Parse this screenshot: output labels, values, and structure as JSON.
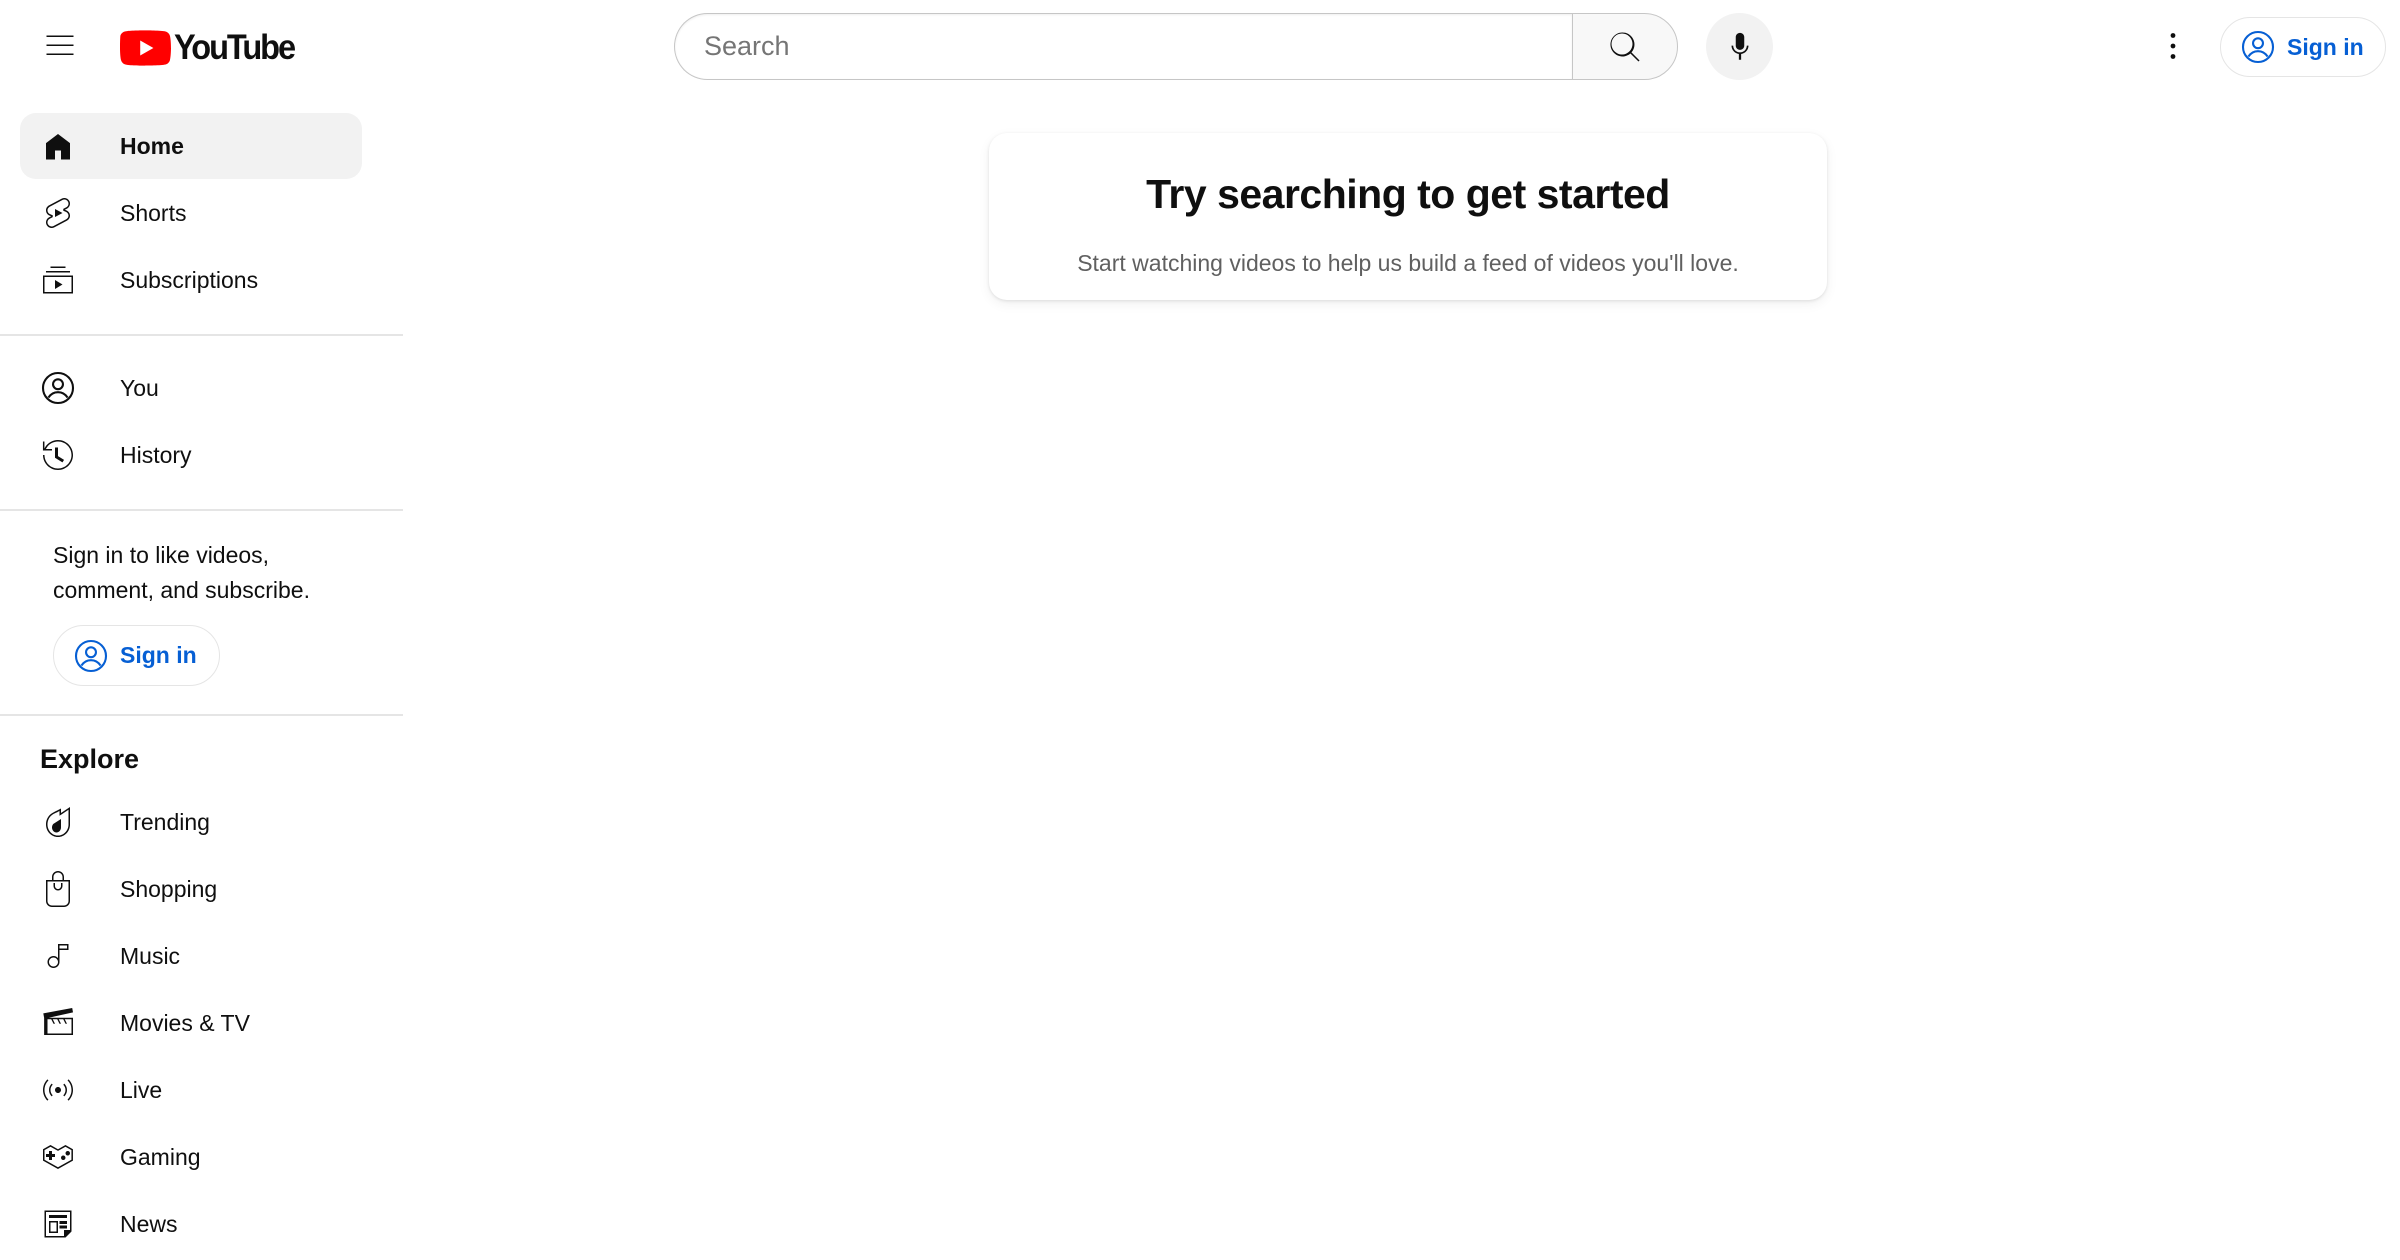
{
  "header": {
    "logo_text": "YouTube",
    "search_placeholder": "Search",
    "signin_label": "Sign in"
  },
  "sidebar": {
    "main_items": [
      {
        "label": "Home",
        "icon": "home-icon",
        "active": true
      },
      {
        "label": "Shorts",
        "icon": "shorts-icon"
      },
      {
        "label": "Subscriptions",
        "icon": "subscriptions-icon"
      }
    ],
    "you_items": [
      {
        "label": "You",
        "icon": "account-icon"
      },
      {
        "label": "History",
        "icon": "history-icon"
      }
    ],
    "signin_prompt": "Sign in to like videos, comment, and subscribe.",
    "signin_label": "Sign in",
    "explore_title": "Explore",
    "explore_items": [
      {
        "label": "Trending",
        "icon": "trending-icon"
      },
      {
        "label": "Shopping",
        "icon": "shopping-icon"
      },
      {
        "label": "Music",
        "icon": "music-icon"
      },
      {
        "label": "Movies & TV",
        "icon": "movies-icon"
      },
      {
        "label": "Live",
        "icon": "live-icon"
      },
      {
        "label": "Gaming",
        "icon": "gaming-icon"
      },
      {
        "label": "News",
        "icon": "news-icon"
      }
    ]
  },
  "main": {
    "title": "Try searching to get started",
    "subtitle": "Start watching videos to help us build a feed of videos you'll love."
  },
  "colors": {
    "brand_red": "#ff0000",
    "link_blue": "#065fd4",
    "text_primary": "#0f0f0f",
    "text_secondary": "#606060",
    "active_bg": "#f2f2f2"
  }
}
